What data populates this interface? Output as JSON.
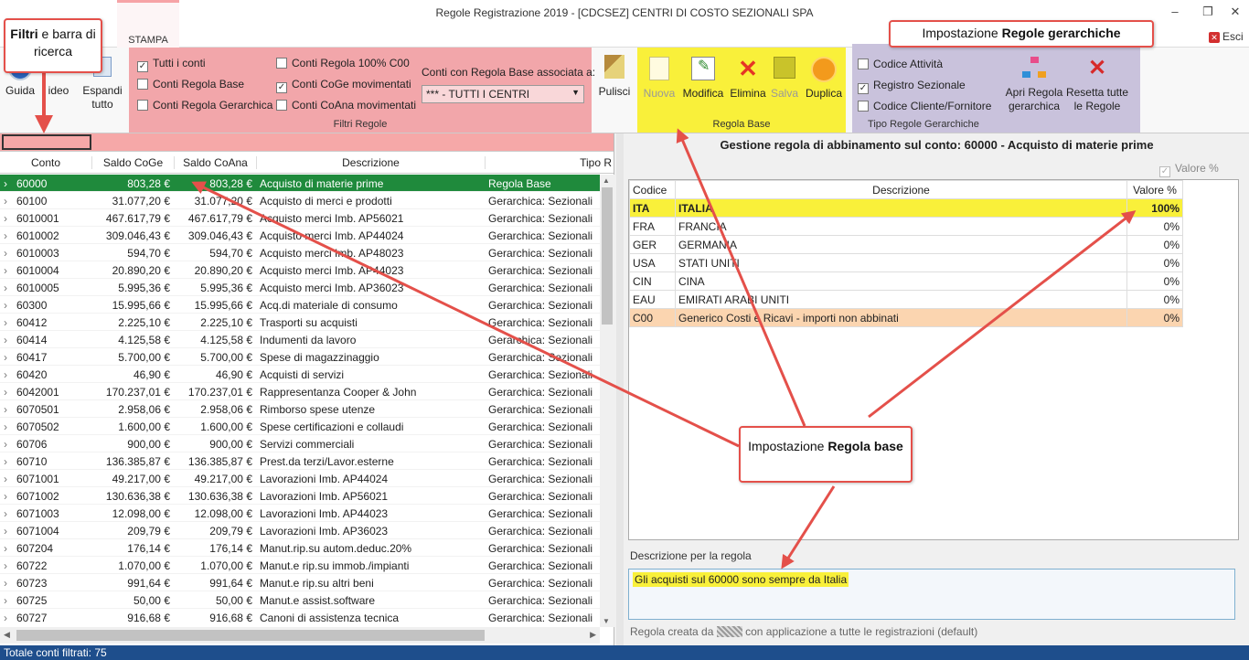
{
  "window": {
    "title": "Regole Registrazione 2019 - [CDCSEZ] CENTRI DI COSTO SEZIONALI SPA",
    "exit_label": "Esci"
  },
  "tabs": {
    "stampa": "STAMPA"
  },
  "ribbon": {
    "guida": "Guida",
    "video": "ideo",
    "espandi": "Espandi tutto",
    "filtri": {
      "label": "Filtri Regole",
      "tutti": "Tutti i conti",
      "base": "Conti Regola Base",
      "gerarchica": "Conti Regola Gerarchica",
      "c100": "Conti Regola 100% C00",
      "coge_mov": "Conti CoGe movimentati",
      "coana_mov": "Conti CoAna movimentati",
      "assoc_label": "Conti con Regola Base associata a:",
      "assoc_value": "*** - TUTTI I CENTRI"
    },
    "pulisci": "Pulisci",
    "base": {
      "label": "Regola Base",
      "nuova": "Nuova",
      "modifica": "Modifica",
      "elimina": "Elimina",
      "salva": "Salva",
      "duplica": "Duplica"
    },
    "tipo": {
      "label": "Tipo Regole Gerarchiche",
      "attivita": "Codice Attività",
      "registro": "Registro Sezionale",
      "cliente": "Codice Cliente/Fornitore"
    },
    "apri": "Apri Regola gerarchica",
    "resetta": "Resetta tutte le Regole"
  },
  "grid": {
    "headers": [
      "Conto",
      "Saldo CoGe",
      "Saldo CoAna",
      "Descrizione",
      "Tipo R"
    ],
    "rows": [
      [
        "60000",
        "803,28 €",
        "803,28 €",
        "Acquisto di materie prime",
        "Regola Base"
      ],
      [
        "60100",
        "31.077,20 €",
        "31.077,20 €",
        "Acquisto di merci e prodotti",
        "Gerarchica: Sezionali"
      ],
      [
        "6010001",
        "467.617,79 €",
        "467.617,79 €",
        "Acquisto merci Imb. AP56021",
        "Gerarchica: Sezionali"
      ],
      [
        "6010002",
        "309.046,43 €",
        "309.046,43 €",
        "Acquisto merci Imb. AP44024",
        "Gerarchica: Sezionali"
      ],
      [
        "6010003",
        "594,70 €",
        "594,70 €",
        "Acquisto merci Imb. AP48023",
        "Gerarchica: Sezionali"
      ],
      [
        "6010004",
        "20.890,20 €",
        "20.890,20 €",
        "Acquisto merci Imb. AP44023",
        "Gerarchica: Sezionali"
      ],
      [
        "6010005",
        "5.995,36 €",
        "5.995,36 €",
        "Acquisto merci Imb. AP36023",
        "Gerarchica: Sezionali"
      ],
      [
        "60300",
        "15.995,66 €",
        "15.995,66 €",
        "Acq.di materiale di consumo",
        "Gerarchica: Sezionali"
      ],
      [
        "60412",
        "2.225,10 €",
        "2.225,10 €",
        "Trasporti su acquisti",
        "Gerarchica: Sezionali"
      ],
      [
        "60414",
        "4.125,58 €",
        "4.125,58 €",
        "Indumenti da lavoro",
        "Gerarchica: Sezionali"
      ],
      [
        "60417",
        "5.700,00 €",
        "5.700,00 €",
        "Spese di magazzinaggio",
        "Gerarchica: Sezionali"
      ],
      [
        "60420",
        "46,90 €",
        "46,90 €",
        "Acquisti di servizi",
        "Gerarchica: Sezionali"
      ],
      [
        "6042001",
        "170.237,01 €",
        "170.237,01 €",
        "Rappresentanza Cooper & John",
        "Gerarchica: Sezionali"
      ],
      [
        "6070501",
        "2.958,06 €",
        "2.958,06 €",
        "Rimborso spese utenze",
        "Gerarchica: Sezionali"
      ],
      [
        "6070502",
        "1.600,00 €",
        "1.600,00 €",
        "Spese certificazioni e collaudi",
        "Gerarchica: Sezionali"
      ],
      [
        "60706",
        "900,00 €",
        "900,00 €",
        "Servizi commerciali",
        "Gerarchica: Sezionali"
      ],
      [
        "60710",
        "136.385,87 €",
        "136.385,87 €",
        "Prest.da terzi/Lavor.esterne",
        "Gerarchica: Sezionali"
      ],
      [
        "6071001",
        "49.217,00 €",
        "49.217,00 €",
        "Lavorazioni Imb. AP44024",
        "Gerarchica: Sezionali"
      ],
      [
        "6071002",
        "130.636,38 €",
        "130.636,38 €",
        "Lavorazioni Imb. AP56021",
        "Gerarchica: Sezionali"
      ],
      [
        "6071003",
        "12.098,00 €",
        "12.098,00 €",
        "Lavorazioni Imb. AP44023",
        "Gerarchica: Sezionali"
      ],
      [
        "6071004",
        "209,79 €",
        "209,79 €",
        "Lavorazioni Imb. AP36023",
        "Gerarchica: Sezionali"
      ],
      [
        "607204",
        "176,14 €",
        "176,14 €",
        "Manut.rip.su autom.deduc.20%",
        "Gerarchica: Sezionali"
      ],
      [
        "60722",
        "1.070,00 €",
        "1.070,00 €",
        "Manut.e rip.su immob./impianti",
        "Gerarchica: Sezionali"
      ],
      [
        "60723",
        "991,64 €",
        "991,64 €",
        "Manut.e rip.su altri beni",
        "Gerarchica: Sezionali"
      ],
      [
        "60725",
        "50,00 €",
        "50,00 €",
        "Manut.e assist.software",
        "Gerarchica: Sezionali"
      ],
      [
        "60727",
        "916,68 €",
        "916,68 €",
        "Canoni di assistenza tecnica",
        "Gerarchica: Sezionali"
      ]
    ]
  },
  "detail": {
    "title": "Gestione regola di abbinamento sul conto: 60000 - Acquisto di materie prime",
    "valore_pct": "Valore %",
    "headers": [
      "Codice",
      "Descrizione",
      "Valore %"
    ],
    "rows": [
      [
        "ITA",
        "ITALIA",
        "100%"
      ],
      [
        "FRA",
        "FRANCIA",
        "0%"
      ],
      [
        "GER",
        "GERMANIA",
        "0%"
      ],
      [
        "USA",
        "STATI UNITI",
        "0%"
      ],
      [
        "CIN",
        "CINA",
        "0%"
      ],
      [
        "EAU",
        "EMIRATI ARABI UNITI",
        "0%"
      ],
      [
        "C00",
        "Generico Costi e Ricavi - importi non abbinati",
        "0%"
      ]
    ],
    "desc_label": "Descrizione per la regola",
    "desc_value": "Gli acquisti sul 60000 sono sempre da Italia",
    "footnote_pre": "Regola creata da",
    "footnote_post": "con applicazione a tutte le registrazioni (default)"
  },
  "status": "Totale conti filtrati: 75",
  "callouts": {
    "filtri": [
      "Filtri",
      " e barra di ricerca"
    ],
    "gerarchiche": [
      "Impostazione ",
      "Regole gerarchiche"
    ],
    "base": [
      "Impostazione ",
      "Regola base"
    ]
  },
  "colors": {
    "accent_green": "#1f8a3c",
    "filter_pink": "#f2a6aa",
    "base_yellow": "#f9f03a",
    "tipo_lilac": "#c9c2dc",
    "callout_red": "#e4504a",
    "status_blue": "#1e4e8c"
  }
}
